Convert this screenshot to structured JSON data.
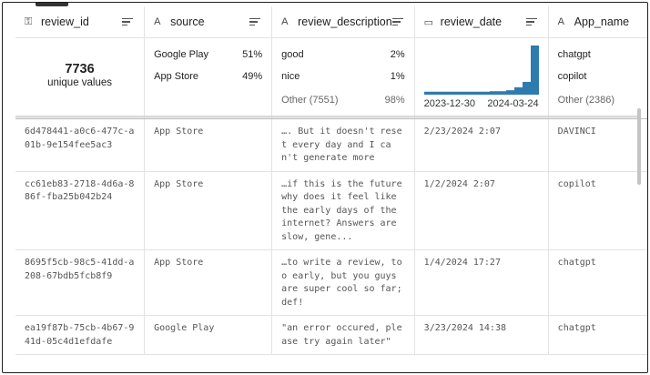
{
  "columns": [
    {
      "name": "review_id",
      "icon": "key-icon",
      "glyph": "⚿"
    },
    {
      "name": "source",
      "icon": "text-type-icon",
      "glyph": "A"
    },
    {
      "name": "review_description",
      "icon": "text-type-icon",
      "glyph": "A"
    },
    {
      "name": "review_date",
      "icon": "calendar-icon",
      "glyph": "▭"
    },
    {
      "name": "App_name",
      "icon": "text-type-icon",
      "glyph": "A"
    }
  ],
  "summary": {
    "review_id": {
      "count": "7736",
      "label": "unique values"
    },
    "source": [
      {
        "label": "Google Play",
        "pct": "51%"
      },
      {
        "label": "App Store",
        "pct": "49%"
      }
    ],
    "review_description": [
      {
        "label": "good",
        "pct": "2%"
      },
      {
        "label": "nice",
        "pct": "1%"
      },
      {
        "label": "Other (7551)",
        "pct": "98%"
      }
    ],
    "review_date": {
      "start": "2023-12-30",
      "end": "2024-03-24",
      "bar_color": "#2e7bb0",
      "histogram": [
        0.06,
        0.06,
        0.06,
        0.06,
        0.06,
        0.06,
        0.06,
        0.06,
        0.07,
        0.07,
        0.09,
        0.15,
        0.26,
        1.0
      ]
    },
    "App_name": [
      "chatgpt",
      "copilot",
      "Other (2386)"
    ]
  },
  "rows": [
    {
      "review_id": "6d478441-a0c6-477c-a01b-9e154fee5ac3",
      "source": "App Store",
      "review_description": "…. But it doesn't reset every day and I can't generate more",
      "review_date": "2/23/2024 2:07",
      "App_name": "DAVINCI"
    },
    {
      "review_id": "cc61eb83-2718-4d6a-886f-fba25b042b24",
      "source": "App Store",
      "review_description": "…if this is the future why does it feel like the early days of the internet? Answers are slow, gene...",
      "review_date": "1/2/2024 2:07",
      "App_name": "copilot"
    },
    {
      "review_id": "8695f5cb-98c5-41dd-a208-67bdb5fcb8f9",
      "source": "App Store",
      "review_description": "…to write a review, too early, but you guys are super cool so far; def!",
      "review_date": "1/4/2024 17:27",
      "App_name": "chatgpt"
    },
    {
      "review_id": "ea19f87b-75cb-4b67-941d-05c4d1efdafe",
      "source": "Google Play",
      "review_description": "\"an error occured, please try again later\"",
      "review_date": "3/23/2024 14:38",
      "App_name": "chatgpt"
    }
  ]
}
